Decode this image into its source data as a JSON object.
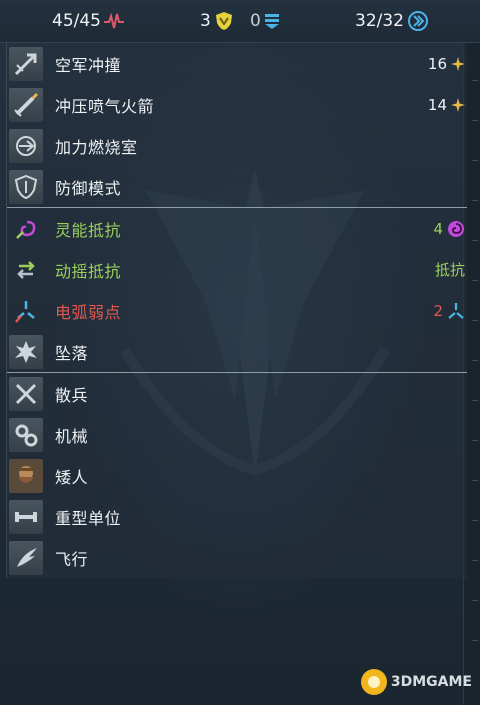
{
  "topbar": {
    "health": "45/45",
    "armor": "3",
    "shield": "0",
    "movement": "32/32"
  },
  "abilities": [
    {
      "label": "空军冲撞",
      "value": "16",
      "icon": "air-ram-icon",
      "color": "white"
    },
    {
      "label": "冲压喷气火箭",
      "value": "14",
      "icon": "ramjet-rocket-icon",
      "color": "white"
    },
    {
      "label": "加力燃烧室",
      "value": "",
      "icon": "afterburner-icon",
      "color": "white"
    },
    {
      "label": "防御模式",
      "value": "",
      "icon": "defense-mode-icon",
      "color": "white"
    }
  ],
  "resistances": [
    {
      "label": "灵能抵抗",
      "value": "4",
      "icon": "psionic-icon",
      "color": "green"
    },
    {
      "label": "动摇抵抗",
      "value": "抵抗",
      "icon": "shaken-icon",
      "color": "green"
    },
    {
      "label": "电弧弱点",
      "value": "2",
      "icon": "arc-icon",
      "color": "red"
    },
    {
      "label": "坠落",
      "value": "",
      "icon": "fall-icon",
      "color": "white"
    }
  ],
  "traits": [
    {
      "label": "散兵",
      "icon": "skirmisher-icon"
    },
    {
      "label": "机械",
      "icon": "mechanical-icon"
    },
    {
      "label": "矮人",
      "icon": "dwarf-icon"
    },
    {
      "label": "重型单位",
      "icon": "heavy-unit-icon"
    },
    {
      "label": "飞行",
      "icon": "flying-icon"
    }
  ],
  "watermark": "3DMGAME",
  "colors": {
    "background": "#1f2b35",
    "green": "#9ad05c",
    "red": "#e0574e",
    "gold": "#e9b94a",
    "shield_blue": "#4bb3e6",
    "health_pink": "#e0566b",
    "armor_yellow": "#e6d23a",
    "psionic_purple": "#c14bd8"
  }
}
